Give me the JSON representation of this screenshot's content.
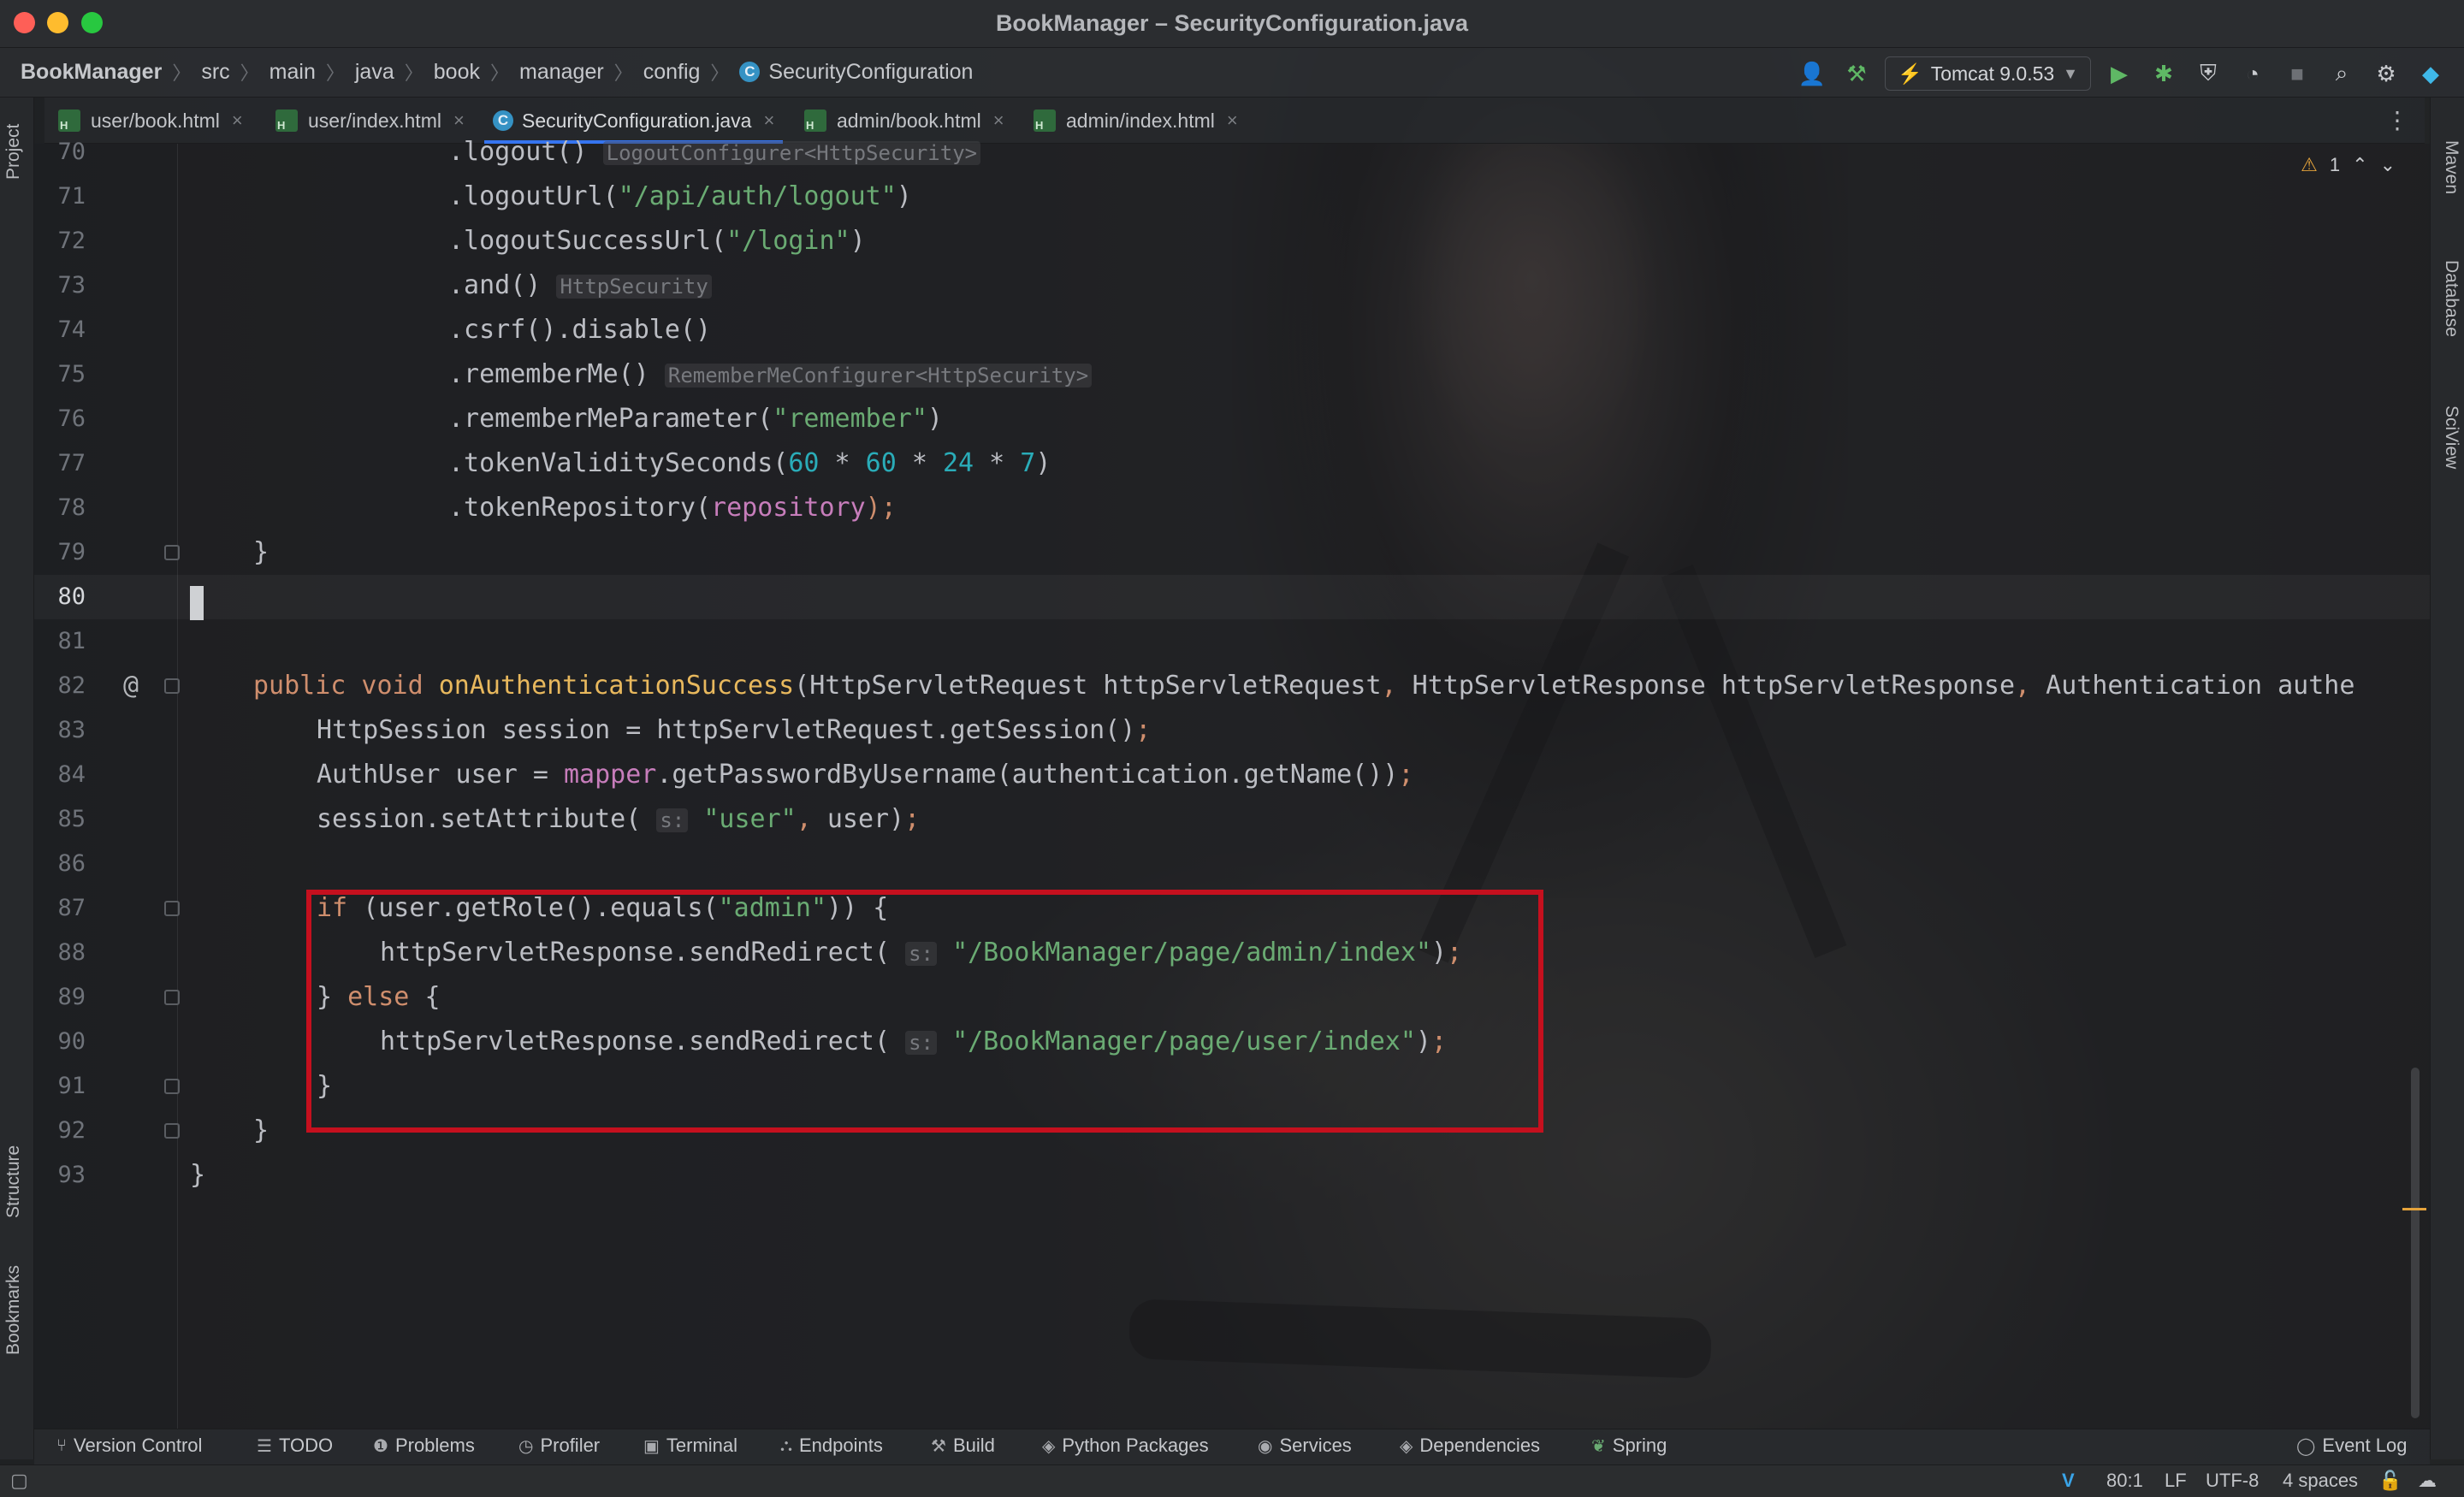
{
  "window": {
    "title": "BookManager – SecurityConfiguration.java"
  },
  "breadcrumb": [
    "BookManager",
    "src",
    "main",
    "java",
    "book",
    "manager",
    "config",
    "SecurityConfiguration"
  ],
  "toolbar": {
    "run_config": "Tomcat 9.0.53"
  },
  "tabs": [
    {
      "label": "user/book.html",
      "active": false
    },
    {
      "label": "user/index.html",
      "active": false
    },
    {
      "label": "SecurityConfiguration.java",
      "active": true
    },
    {
      "label": "admin/book.html",
      "active": false
    },
    {
      "label": "admin/index.html",
      "active": false
    }
  ],
  "left_tools": {
    "project": "Project",
    "structure": "Structure",
    "bookmarks": "Bookmarks"
  },
  "right_tools": {
    "maven": "Maven",
    "database": "Database",
    "sciview": "SciView"
  },
  "inspections": {
    "warnings": "1"
  },
  "editor": {
    "current_line": "80",
    "lines": [
      {
        "n": "70",
        "indent": 0,
        "code": ".logout()",
        "hint": "LogoutConfigurer<HttpSecurity>"
      },
      {
        "n": "71",
        "code": ".logoutUrl(\"/api/auth/logout\")"
      },
      {
        "n": "72",
        "code": ".logoutSuccessUrl(\"/login\")"
      },
      {
        "n": "73",
        "code": ".and()",
        "hint": "HttpSecurity"
      },
      {
        "n": "74",
        "code": ".csrf().disable()"
      },
      {
        "n": "75",
        "code": ".rememberMe()",
        "hint": "RememberMeConfigurer<HttpSecurity>"
      },
      {
        "n": "76",
        "code": ".rememberMeParameter(\"remember\")"
      },
      {
        "n": "77",
        "code": ".tokenValiditySeconds(60 * 60 * 24 * 7)"
      },
      {
        "n": "78",
        "code": ".tokenRepository(repository);"
      },
      {
        "n": "79",
        "code": "}"
      },
      {
        "n": "80",
        "code": ""
      },
      {
        "n": "81",
        "code": ""
      },
      {
        "n": "82",
        "code": "public void onAuthenticationSuccess(HttpServletRequest httpServletRequest, HttpServletResponse httpServletResponse, Authentication authe"
      },
      {
        "n": "83",
        "code": "HttpSession session = httpServletRequest.getSession();"
      },
      {
        "n": "84",
        "code": "AuthUser user = mapper.getPasswordByUsername(authentication.getName());"
      },
      {
        "n": "85",
        "code": "session.setAttribute( s: \"user\", user);"
      },
      {
        "n": "86",
        "code": ""
      },
      {
        "n": "87",
        "code": "if (user.getRole().equals(\"admin\")) {"
      },
      {
        "n": "88",
        "code": "httpServletResponse.sendRedirect( s: \"/BookManager/page/admin/index\");"
      },
      {
        "n": "89",
        "code": "} else {"
      },
      {
        "n": "90",
        "code": "httpServletResponse.sendRedirect( s: \"/BookManager/page/user/index\");"
      },
      {
        "n": "91",
        "code": "}"
      },
      {
        "n": "92",
        "code": "}"
      },
      {
        "n": "93",
        "code": "}"
      }
    ],
    "annotation_symbol": "@"
  },
  "bottom_tools": [
    "Version Control",
    "TODO",
    "Problems",
    "Profiler",
    "Terminal",
    "Endpoints",
    "Build",
    "Python Packages",
    "Services",
    "Dependencies",
    "Spring",
    "Event Log"
  ],
  "status": {
    "position": "80:1",
    "line_sep": "LF",
    "encoding": "UTF-8",
    "indent": "4 spaces"
  },
  "colors": {
    "keyword": "#cf8e6d",
    "string": "#6aab73",
    "number": "#2aacb8",
    "field": "#c77dbb",
    "method_decl": "#e8b85d",
    "highlight_border": "#c5101e",
    "active_tab_underline": "#3574f0"
  }
}
